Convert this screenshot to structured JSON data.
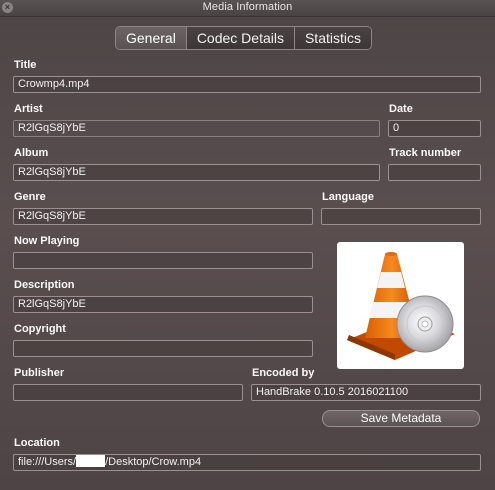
{
  "window": {
    "title": "Media Information"
  },
  "tabs": [
    {
      "label": "General",
      "active": true
    },
    {
      "label": "Codec Details",
      "active": false
    },
    {
      "label": "Statistics",
      "active": false
    }
  ],
  "fields": {
    "title": {
      "label": "Title",
      "value": "Crowmp4.mp4"
    },
    "artist": {
      "label": "Artist",
      "value": "R2lGqS8jYbE"
    },
    "date": {
      "label": "Date",
      "value": "0"
    },
    "album": {
      "label": "Album",
      "value": "R2lGqS8jYbE"
    },
    "track_number": {
      "label": "Track number",
      "value": ""
    },
    "genre": {
      "label": "Genre",
      "value": "R2lGqS8jYbE"
    },
    "language": {
      "label": "Language",
      "value": ""
    },
    "now_playing": {
      "label": "Now Playing",
      "value": ""
    },
    "description": {
      "label": "Description",
      "value": "R2lGqS8jYbE"
    },
    "copyright": {
      "label": "Copyright",
      "value": ""
    },
    "publisher": {
      "label": "Publisher",
      "value": ""
    },
    "encoded_by": {
      "label": "Encoded by",
      "value": "HandBrake 0.10.5 2016021100"
    },
    "location": {
      "label": "Location",
      "prefix": "file:///Users/",
      "suffix": "/Desktop/Crow.mp4"
    }
  },
  "buttons": {
    "save_metadata": "Save Metadata"
  },
  "icons": {
    "close": "close-icon",
    "artwork": "vlc-cone-icon"
  }
}
